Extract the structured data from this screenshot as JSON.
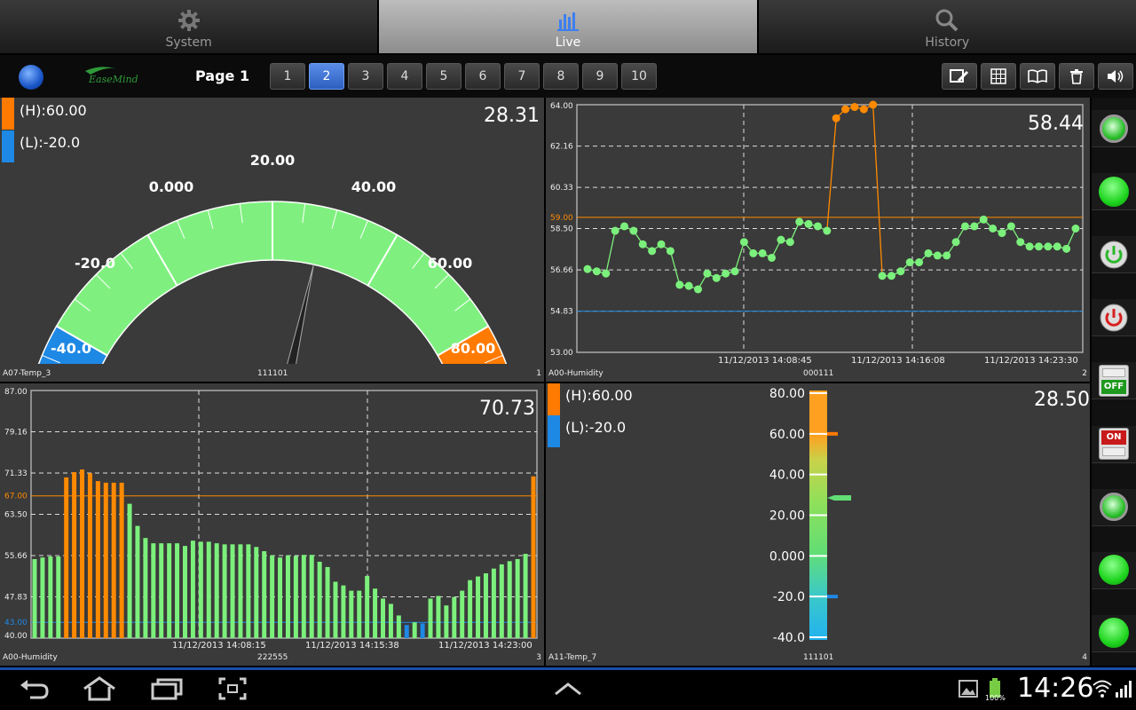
{
  "tabs": [
    {
      "label": "System"
    },
    {
      "label": "Live"
    },
    {
      "label": "History"
    }
  ],
  "toolbar": {
    "logo_text": "EaseMind",
    "page_label": "Page 1",
    "pages": [
      "1",
      "2",
      "3",
      "4",
      "5",
      "6",
      "7",
      "8",
      "9",
      "10"
    ],
    "selected_page": "2"
  },
  "panels": {
    "gauge": {
      "high_label": "(H):60.00",
      "low_label": "(L):-20.0",
      "value": "28.31",
      "gauge_value": 28.31,
      "ticks": [
        "-40.0",
        "-20.0",
        "0.000",
        "20.00",
        "40.00",
        "60.00",
        "80.00"
      ],
      "name": "A07-Temp_3",
      "code": "111101",
      "index": "1"
    },
    "line": {
      "value": "58.44",
      "name": "A00-Humidity",
      "code": "000111",
      "index": "2",
      "ylabels": [
        "64.00",
        "62.16",
        "60.33",
        "58.50",
        "56.66",
        "54.83",
        "53.00"
      ],
      "xlabels": [
        "11/12/2013 14:08:45",
        "11/12/2013 14:16:08",
        "11/12/2013 14:23:30"
      ],
      "high": "59.00",
      "low": "54.83"
    },
    "bar": {
      "value": "70.73",
      "name": "A00-Humidity",
      "code": "222555",
      "index": "3",
      "ylabels": [
        "87.00",
        "79.16",
        "71.33",
        "63.50",
        "55.66",
        "47.83",
        "40.00"
      ],
      "xlabels": [
        "11/12/2013 14:08:15",
        "11/12/2013 14:15:38",
        "11/12/2013 14:23:00"
      ],
      "high": "67.00",
      "low": "43.00"
    },
    "thermo": {
      "high_label": "(H):60.00",
      "low_label": "(L):-20.0",
      "value": "28.50",
      "gauge_value": 28.5,
      "ticks": [
        "80.00",
        "60.00",
        "40.00",
        "20.00",
        "0.000",
        "-20.0",
        "-40.0"
      ],
      "name": "A11-Temp_7",
      "code": "111101",
      "index": "4"
    }
  },
  "chart_data": [
    {
      "type": "line",
      "title": "",
      "ylim": [
        53,
        64
      ],
      "high": 59,
      "low": 54.83,
      "values": [
        56.7,
        56.6,
        56.5,
        58.4,
        58.6,
        58.4,
        57.8,
        57.5,
        57.8,
        57.5,
        56,
        55.95,
        55.8,
        56.5,
        56.3,
        56.5,
        56.6,
        57.9,
        57.4,
        57.4,
        57.2,
        58,
        57.9,
        58.8,
        58.7,
        58.6,
        58.4,
        63.4,
        63.8,
        63.9,
        63.8,
        64,
        56.4,
        56.4,
        56.6,
        57,
        57,
        57.4,
        57.3,
        57.3,
        57.9,
        58.6,
        58.6,
        58.9,
        58.5,
        58.3,
        58.6,
        57.9,
        57.7,
        57.7,
        57.7,
        57.7,
        57.6,
        58.5
      ],
      "colors": "orange above high, green otherwise"
    },
    {
      "type": "bar",
      "title": "",
      "ylim": [
        40,
        87
      ],
      "high": 67,
      "low": 43,
      "values": [
        55,
        55.3,
        55.5,
        55.5,
        70.5,
        71.5,
        72,
        71.3,
        69.8,
        69.5,
        69.5,
        69.5,
        65.5,
        61.3,
        59,
        58,
        58,
        58,
        58,
        57.5,
        58.5,
        58.3,
        58.3,
        58,
        57.8,
        57.8,
        57.8,
        57.8,
        57.3,
        56.5,
        55.7,
        55.3,
        55.7,
        55.6,
        55.8,
        55.8,
        54.5,
        53.5,
        50.7,
        50,
        49,
        49,
        51.8,
        49.4,
        47.5,
        46.5,
        44.3,
        42.5,
        43,
        42.8,
        47.5,
        48,
        46.2,
        47.8,
        49,
        51,
        51.7,
        52.3,
        53.2,
        54,
        54.6,
        55,
        56,
        70.7
      ],
      "colors": "orange above high, blue below low, green otherwise"
    }
  ],
  "side_buttons": [
    "led-green",
    "led-green-solid",
    "power-green",
    "power-red",
    "toggle-off",
    "toggle-on",
    "led-green",
    "led-green-solid",
    "led-green-solid"
  ],
  "side_text": {
    "off": "OFF",
    "on": "ON"
  },
  "status": {
    "time": "14:26",
    "battery": "100%"
  }
}
